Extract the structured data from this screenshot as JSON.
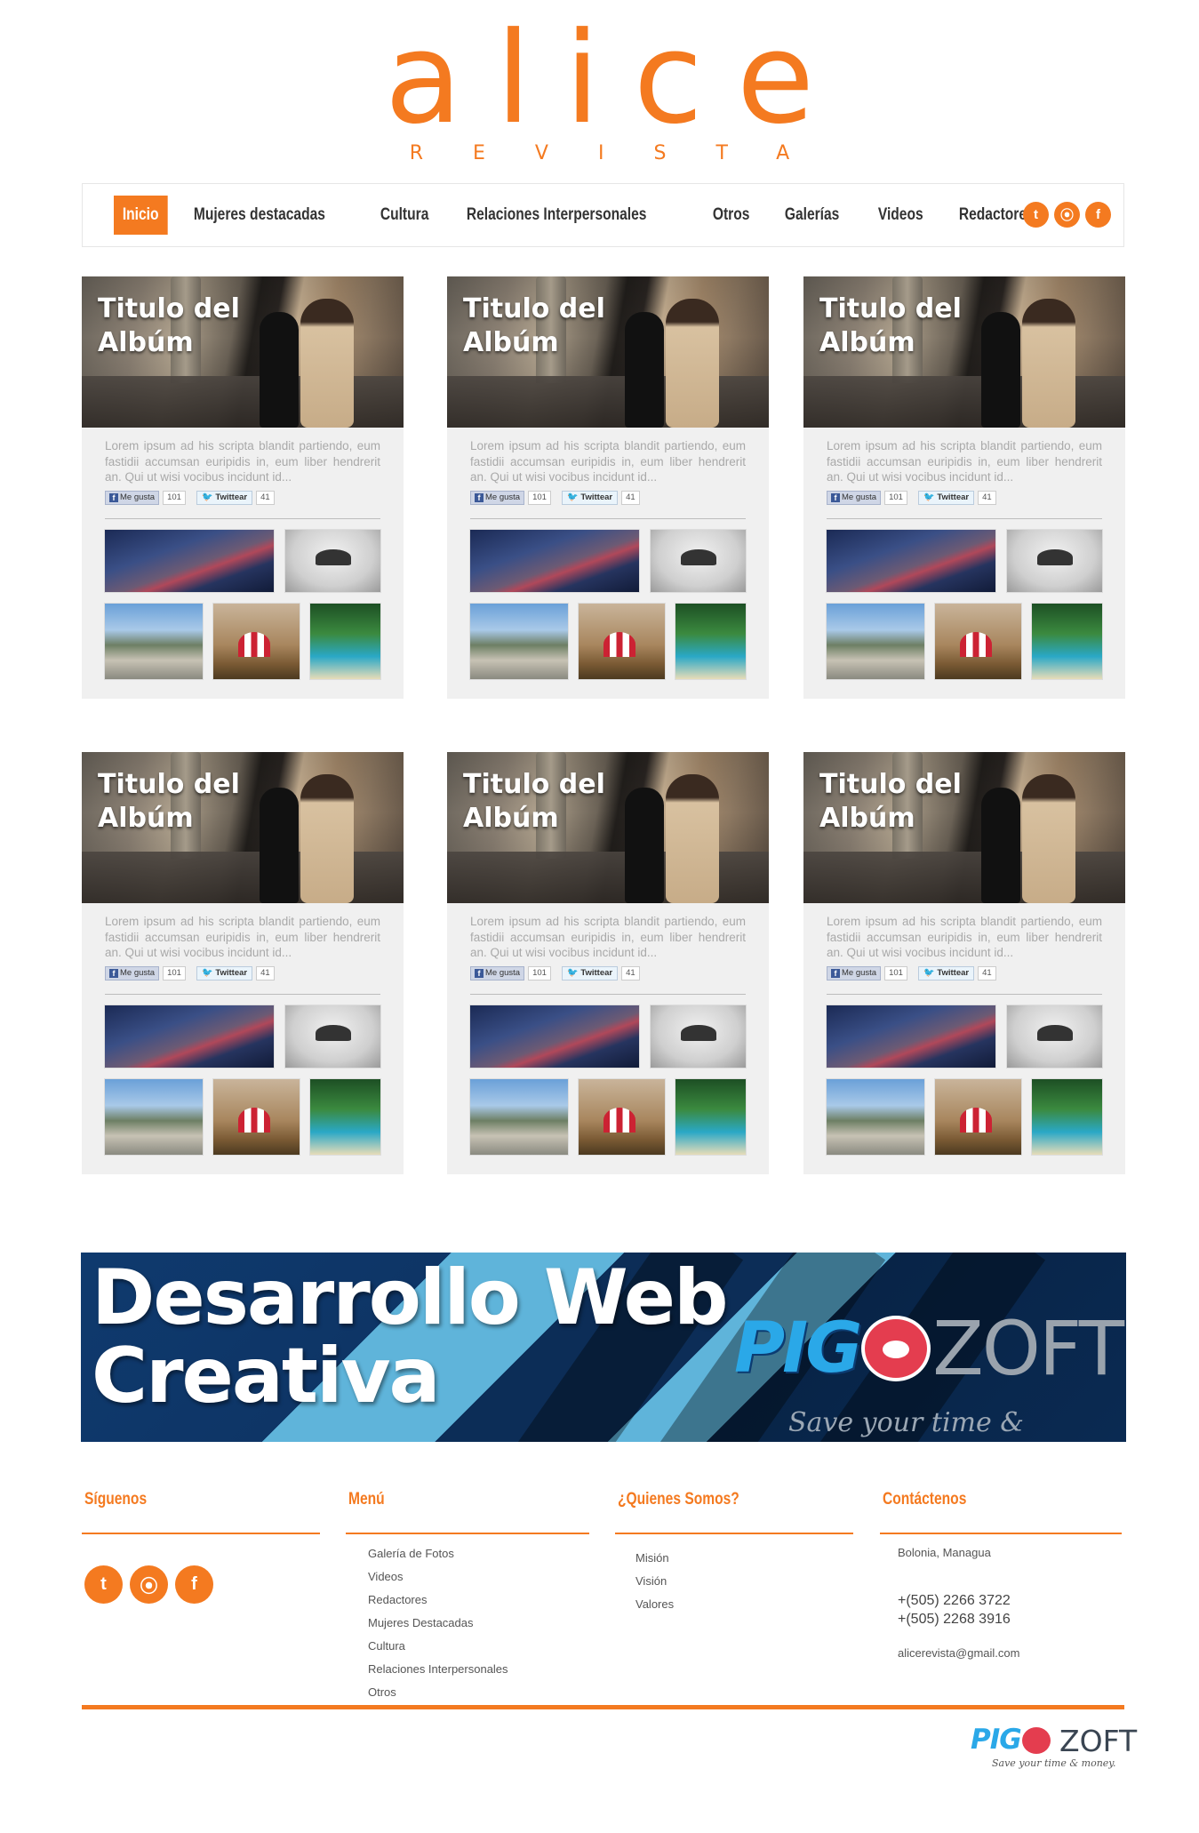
{
  "logo": {
    "word": "alice",
    "sub": "REVISTA"
  },
  "nav": {
    "items": [
      {
        "label": "Inicio",
        "active": true
      },
      {
        "label": "Mujeres destacadas"
      },
      {
        "label": "Cultura"
      },
      {
        "label": "Relaciones Interpersonales"
      },
      {
        "label": "Otros"
      },
      {
        "label": "Galerías"
      },
      {
        "label": "Videos"
      },
      {
        "label": "Redactores"
      }
    ],
    "socials": [
      "twitter-icon",
      "rss-icon",
      "facebook-icon"
    ]
  },
  "cards": [
    {
      "title_line1": "Titulo del",
      "title_line2": "Albúm",
      "text": "Lorem ipsum ad his scripta blandit partiendo, eum fastidii accumsan euripidis in, eum liber hendrerit an. Qui ut wisi vocibus incidunt id...",
      "like_label": "Me gusta",
      "like_count": "101",
      "tweet_label": "Twittear",
      "tweet_count": "41"
    },
    {
      "title_line1": "Titulo del",
      "title_line2": "Albúm",
      "text": "Lorem ipsum ad his scripta blandit partiendo, eum fastidii accumsan euripidis in, eum liber hendrerit an. Qui ut wisi vocibus incidunt id...",
      "like_label": "Me gusta",
      "like_count": "101",
      "tweet_label": "Twittear",
      "tweet_count": "41"
    },
    {
      "title_line1": "Titulo del",
      "title_line2": "Albúm",
      "text": "Lorem ipsum ad his scripta blandit partiendo, eum fastidii accumsan euripidis in, eum liber hendrerit an. Qui ut wisi vocibus incidunt id...",
      "like_label": "Me gusta",
      "like_count": "101",
      "tweet_label": "Twittear",
      "tweet_count": "41"
    },
    {
      "title_line1": "Titulo del",
      "title_line2": "Albúm",
      "text": "Lorem ipsum ad his scripta blandit partiendo, eum fastidii accumsan euripidis in, eum liber hendrerit an. Qui ut wisi vocibus incidunt id...",
      "like_label": "Me gusta",
      "like_count": "101",
      "tweet_label": "Twittear",
      "tweet_count": "41"
    },
    {
      "title_line1": "Titulo del",
      "title_line2": "Albúm",
      "text": "Lorem ipsum ad his scripta blandit partiendo, eum fastidii accumsan euripidis in, eum liber hendrerit an. Qui ut wisi vocibus incidunt id...",
      "like_label": "Me gusta",
      "like_count": "101",
      "tweet_label": "Twittear",
      "tweet_count": "41"
    },
    {
      "title_line1": "Titulo del",
      "title_line2": "Albúm",
      "text": "Lorem ipsum ad his scripta blandit partiendo, eum fastidii accumsan euripidis in, eum liber hendrerit an. Qui ut wisi vocibus incidunt id...",
      "like_label": "Me gusta",
      "like_count": "101",
      "tweet_label": "Twittear",
      "tweet_count": "41"
    }
  ],
  "banner": {
    "line1": "Desarrollo Web",
    "line2": "Creativa",
    "brand_left": "PIG",
    "brand_right": "ZOFT",
    "tagline": "Save your time & money."
  },
  "footer": {
    "siguenos": {
      "heading": "Síguenos",
      "socials": [
        "twitter-icon",
        "rss-icon",
        "facebook-icon"
      ]
    },
    "menu": {
      "heading": "Menú",
      "items": [
        "Galería de Fotos",
        "Videos",
        "Redactores",
        "Mujeres Destacadas",
        "Cultura",
        "Relaciones Interpersonales",
        "Otros"
      ]
    },
    "quienes": {
      "heading": "¿Quienes Somos?",
      "items": [
        "Misión",
        "Visión",
        "Valores"
      ]
    },
    "contacto": {
      "heading": "Contáctenos",
      "address": "Bolonia, Managua",
      "phone1": "+(505) 2266 3722",
      "phone2": "+(505) 2268 3916",
      "email": "alicerevista@gmail.com"
    },
    "mini_brand": {
      "left": "PIG",
      "right": "ZOFT",
      "tagline": "Save your time & money."
    }
  },
  "colors": {
    "accent": "#f47a20",
    "card_bg": "#f0f0f0",
    "banner_dark": "#0c2d57",
    "banner_light": "#5fb4da"
  }
}
